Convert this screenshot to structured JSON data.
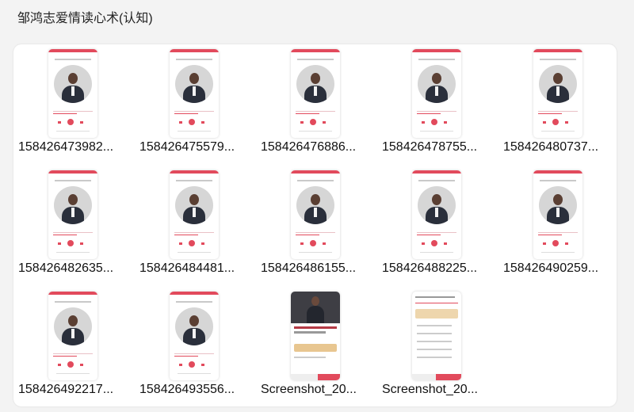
{
  "window": {
    "title": "邹鸿志爱情读心术(认知)"
  },
  "files": [
    {
      "name": "158426473982...",
      "kind": "player"
    },
    {
      "name": "158426475579...",
      "kind": "player"
    },
    {
      "name": "158426476886...",
      "kind": "player"
    },
    {
      "name": "158426478755...",
      "kind": "player"
    },
    {
      "name": "158426480737...",
      "kind": "player"
    },
    {
      "name": "158426482635...",
      "kind": "player"
    },
    {
      "name": "158426484481...",
      "kind": "player"
    },
    {
      "name": "158426486155...",
      "kind": "player"
    },
    {
      "name": "158426488225...",
      "kind": "player"
    },
    {
      "name": "158426490259...",
      "kind": "player"
    },
    {
      "name": "158426492217...",
      "kind": "player"
    },
    {
      "name": "158426493556...",
      "kind": "player"
    },
    {
      "name": "Screenshot_20...",
      "kind": "article"
    },
    {
      "name": "Screenshot_20...",
      "kind": "catalog"
    }
  ],
  "colors": {
    "accent": "#e24a5c",
    "panel": "#ffffff",
    "background": "#f3f3f3"
  }
}
